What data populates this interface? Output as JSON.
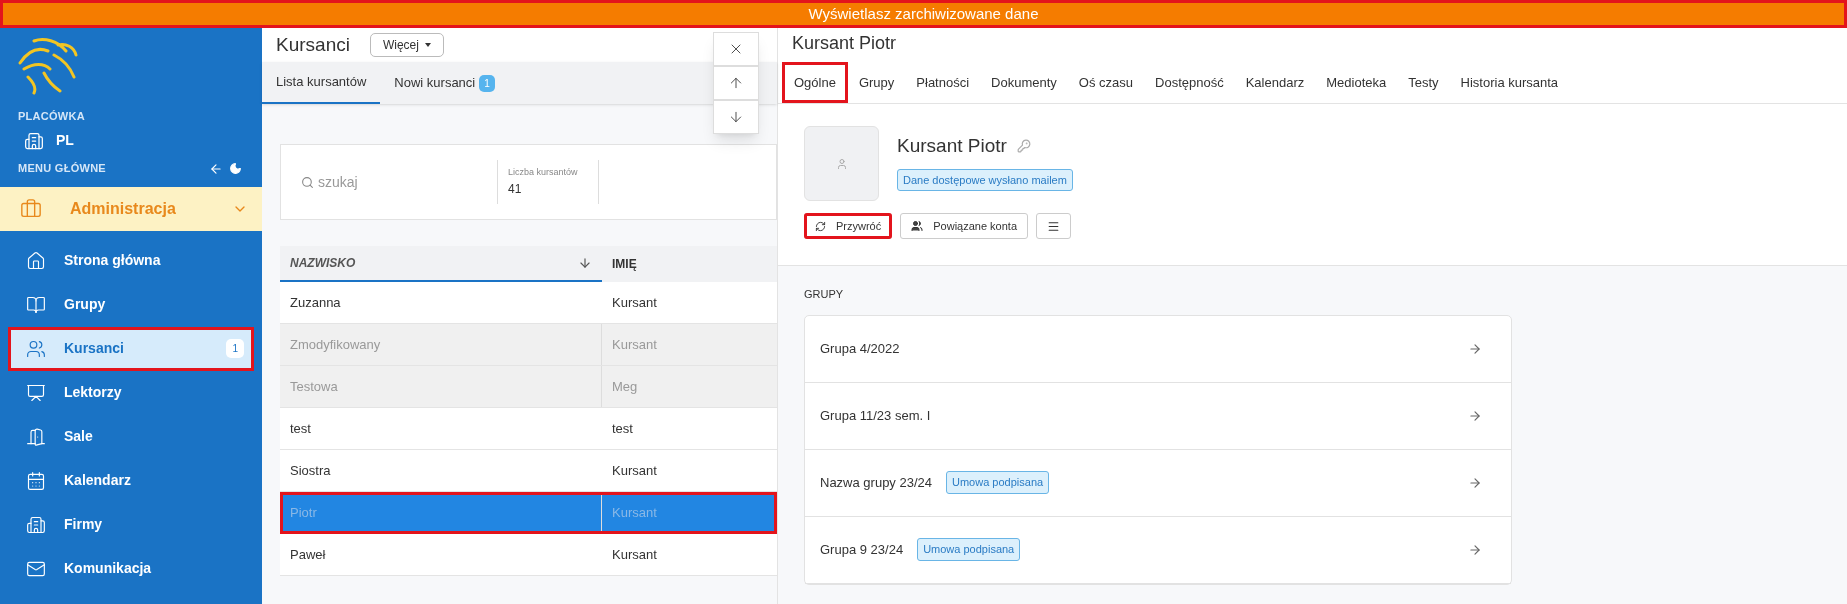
{
  "banner": {
    "text": "Wyświetlasz zarchiwizowane dane",
    "highlighted": true
  },
  "sidebar": {
    "branch_label": "PLACÓWKA",
    "branch": "PL",
    "menu_label": "MENU GŁÓWNE",
    "section": {
      "label": "Administracja",
      "expanded": true
    },
    "items": [
      {
        "label": "Strona główna",
        "selected": false,
        "highlighted": false
      },
      {
        "label": "Grupy",
        "selected": false,
        "highlighted": false
      },
      {
        "label": "Kursanci",
        "selected": true,
        "highlighted": true,
        "badge": "1"
      },
      {
        "label": "Lektorzy",
        "selected": false,
        "highlighted": false
      },
      {
        "label": "Sale",
        "selected": false,
        "highlighted": false
      },
      {
        "label": "Kalendarz",
        "selected": false,
        "highlighted": false
      },
      {
        "label": "Firmy",
        "selected": false,
        "highlighted": false
      },
      {
        "label": "Komunikacja",
        "selected": false,
        "highlighted": false
      }
    ]
  },
  "list_panel": {
    "title": "Kursanci",
    "more_button": "Więcej",
    "tabs": [
      {
        "label": "Lista kursantów",
        "selected": true
      },
      {
        "label": "Nowi kursanci",
        "selected": false,
        "badge": "1"
      }
    ],
    "search": {
      "placeholder": "szukaj"
    },
    "stat": {
      "label": "Liczba kursantów",
      "value": "41"
    },
    "table": {
      "columns": [
        {
          "label": "NAZWISKO",
          "sorted": true
        },
        {
          "label": "IMIĘ",
          "sorted": false
        }
      ],
      "rows": [
        {
          "cells": [
            "Zuzanna",
            "Kursant"
          ],
          "archived": false,
          "selected": false,
          "highlighted": false
        },
        {
          "cells": [
            "Zmodyfikowany",
            "Kursant"
          ],
          "archived": true,
          "selected": false,
          "highlighted": false
        },
        {
          "cells": [
            "Testowa",
            "Meg"
          ],
          "archived": true,
          "selected": false,
          "highlighted": false
        },
        {
          "cells": [
            "test",
            "test"
          ],
          "archived": false,
          "selected": false,
          "highlighted": false
        },
        {
          "cells": [
            "Siostra",
            "Kursant"
          ],
          "archived": false,
          "selected": false,
          "highlighted": false
        },
        {
          "cells": [
            "Piotr",
            "Kursant"
          ],
          "archived": false,
          "selected": true,
          "highlighted": true
        },
        {
          "cells": [
            "Paweł",
            "Kursant"
          ],
          "archived": false,
          "selected": false,
          "highlighted": false
        }
      ]
    }
  },
  "detail_panel": {
    "title": "Kursant Piotr",
    "tabs": [
      {
        "label": "Ogólne",
        "selected": true,
        "highlighted": true
      },
      {
        "label": "Grupy",
        "selected": false,
        "highlighted": false
      },
      {
        "label": "Płatności",
        "selected": false,
        "highlighted": false
      },
      {
        "label": "Dokumenty",
        "selected": false,
        "highlighted": false
      },
      {
        "label": "Oś czasu",
        "selected": false,
        "highlighted": false
      },
      {
        "label": "Dostępność",
        "selected": false,
        "highlighted": false
      },
      {
        "label": "Kalendarz",
        "selected": false,
        "highlighted": false
      },
      {
        "label": "Medioteka",
        "selected": false,
        "highlighted": false
      },
      {
        "label": "Testy",
        "selected": false,
        "highlighted": false
      },
      {
        "label": "Historia kursanta",
        "selected": false,
        "highlighted": false
      }
    ],
    "name": "Kursant Piotr",
    "status_badge": "Dane dostępowe wysłano mailem",
    "actions": [
      {
        "kind": "restore",
        "label": "Przywróć",
        "highlighted": true
      },
      {
        "kind": "linked",
        "label": "Powiązane konta",
        "highlighted": false
      },
      {
        "kind": "menu",
        "highlighted": false
      }
    ],
    "groups_label": "GRUPY",
    "groups": [
      {
        "name": "Grupa 4/2022"
      },
      {
        "name": "Grupa 11/23 sem. I"
      },
      {
        "name": "Nazwa grupy 23/24",
        "badge": "Umowa podpisana"
      },
      {
        "name": "Grupa 9 23/24",
        "badge": "Umowa podpisana"
      }
    ]
  }
}
